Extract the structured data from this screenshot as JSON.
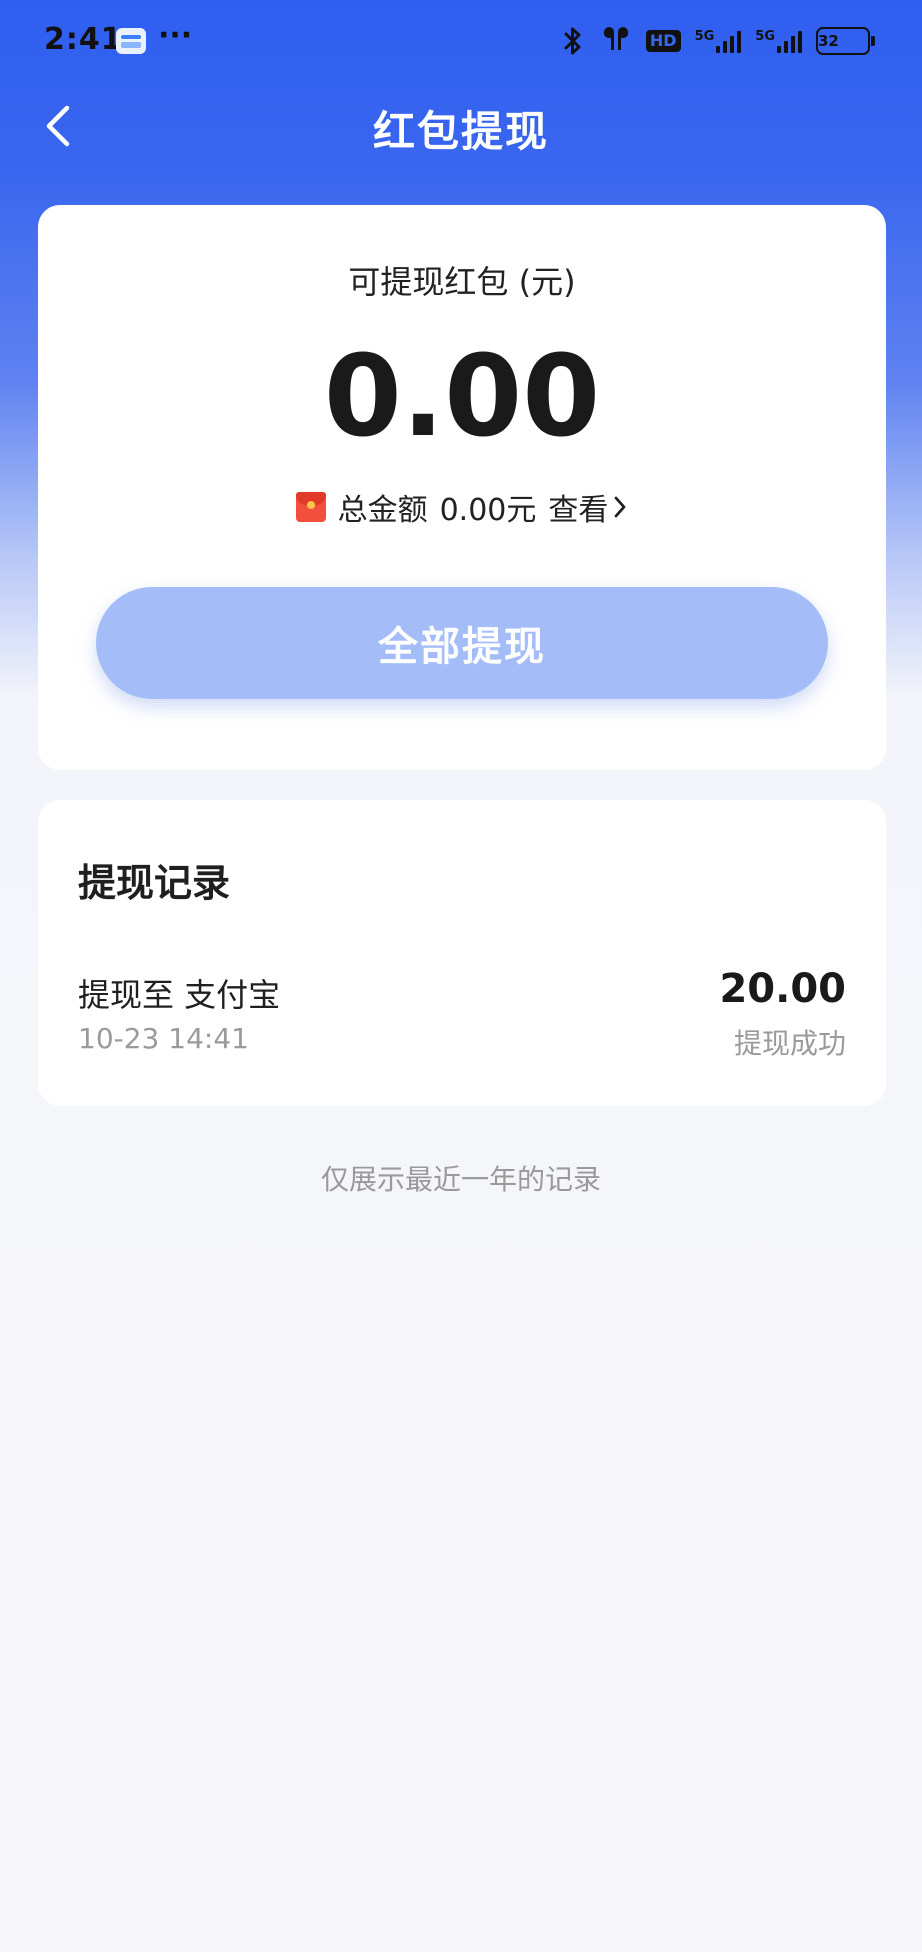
{
  "status_bar": {
    "time": "2:41",
    "dots": "···",
    "hd_label": "HD",
    "network_label_1": "5G",
    "network_label_2": "5G",
    "battery_level": "32"
  },
  "nav": {
    "title": "红包提现"
  },
  "balance": {
    "label": "可提现红包 (元)",
    "amount": "0.00",
    "total_prefix": "总金额",
    "total_value": "0.00元",
    "view_label": "查看"
  },
  "actions": {
    "withdraw_all_label": "全部提现"
  },
  "records": {
    "title": "提现记录",
    "items": [
      {
        "destination": "提现至 支付宝",
        "time": "10-23 14:41",
        "amount": "20.00",
        "status": "提现成功"
      }
    ]
  },
  "footer": {
    "note": "仅展示最近一年的记录"
  },
  "icons": {
    "back": "chevron-left-icon",
    "bluetooth": "bluetooth-icon",
    "earbuds": "earbuds-icon",
    "signal": "signal-icon",
    "battery": "battery-icon",
    "envelope": "red-envelope-icon",
    "view_arrow": "chevron-right-icon"
  },
  "colors": {
    "header_blue": "#2f5ff0",
    "button_disabled_blue": "#a4bdf9",
    "envelope_red": "#f2503c"
  }
}
